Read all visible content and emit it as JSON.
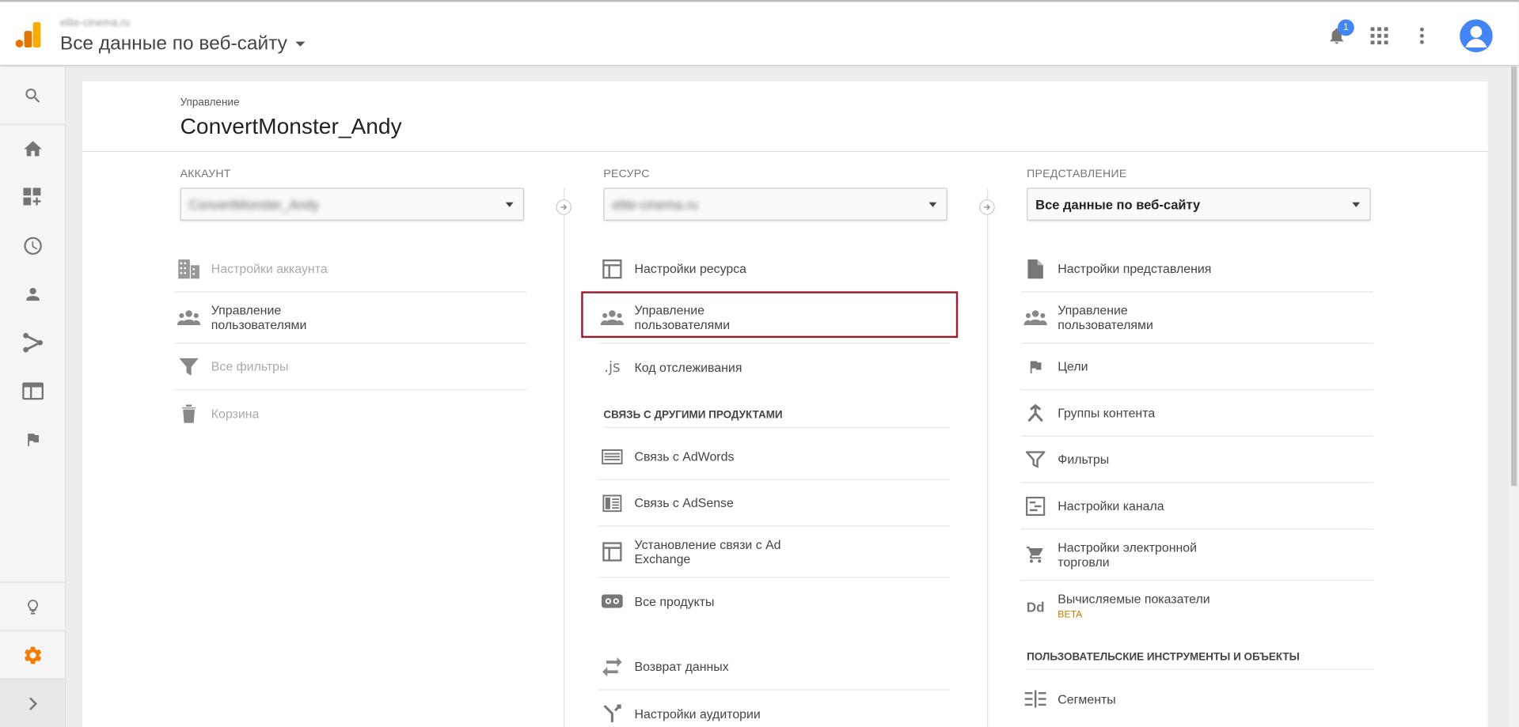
{
  "header": {
    "site_name": "elite-cinema.ru",
    "view_title": "Все данные по веб-сайту",
    "notification_count": "1"
  },
  "page": {
    "breadcrumb": "Управление",
    "title": "ConvertMonster_Andy"
  },
  "account": {
    "label": "АККАУНТ",
    "selected": "ConvertMonster_Andy",
    "items": [
      {
        "label": "Настройки аккаунта",
        "icon": "building-icon",
        "disabled": true
      },
      {
        "label": "Управление пользователями",
        "icon": "users-icon",
        "disabled": false
      },
      {
        "label": "Все фильтры",
        "icon": "filter-icon",
        "disabled": true
      },
      {
        "label": "Корзина",
        "icon": "trash-icon",
        "disabled": true
      }
    ]
  },
  "property": {
    "label": "РЕСУРС",
    "selected": "elite-cinema.ru",
    "items": [
      {
        "label": "Настройки ресурса",
        "icon": "layout-icon"
      },
      {
        "label": "Управление пользователями",
        "icon": "users-icon"
      },
      {
        "label": "Код отслеживания",
        "icon": "js-icon"
      }
    ],
    "links_heading": "СВЯЗЬ С ДРУГИМИ ПРОДУКТАМИ",
    "links": [
      {
        "label": "Связь с AdWords",
        "icon": "adwords-icon"
      },
      {
        "label": "Связь с AdSense",
        "icon": "adsense-icon"
      },
      {
        "label": "Установление связи с Ad Exchange",
        "icon": "adexchange-icon"
      },
      {
        "label": "Все продукты",
        "icon": "link-icon"
      }
    ],
    "extra": [
      {
        "label": "Возврат данных",
        "icon": "swap-icon"
      },
      {
        "label": "Настройки аудитории",
        "icon": "fork-icon"
      }
    ]
  },
  "view": {
    "label": "ПРЕДСТАВЛЕНИЕ",
    "selected": "Все данные по веб-сайту",
    "items": [
      {
        "label": "Настройки представления",
        "icon": "document-icon"
      },
      {
        "label": "Управление пользователями",
        "icon": "users-icon"
      },
      {
        "label": "Цели",
        "icon": "flag-icon"
      },
      {
        "label": "Группы контента",
        "icon": "content-group-icon"
      },
      {
        "label": "Фильтры",
        "icon": "filter-icon"
      },
      {
        "label": "Настройки канала",
        "icon": "channel-icon"
      },
      {
        "label": "Настройки электронной торговли",
        "icon": "cart-icon"
      },
      {
        "label": "Вычисляемые показатели",
        "badge": "BETA",
        "icon": "dd-icon"
      }
    ],
    "tools_heading": "ПОЛЬЗОВАТЕЛЬСКИЕ ИНСТРУМЕНТЫ И ОБЪЕКТЫ",
    "tools": [
      {
        "label": "Сегменты",
        "icon": "segments-icon"
      }
    ]
  },
  "colors": {
    "highlight": "#9b1b2f",
    "accent_orange": "#f57c00",
    "badge_blue": "#4285f4"
  }
}
